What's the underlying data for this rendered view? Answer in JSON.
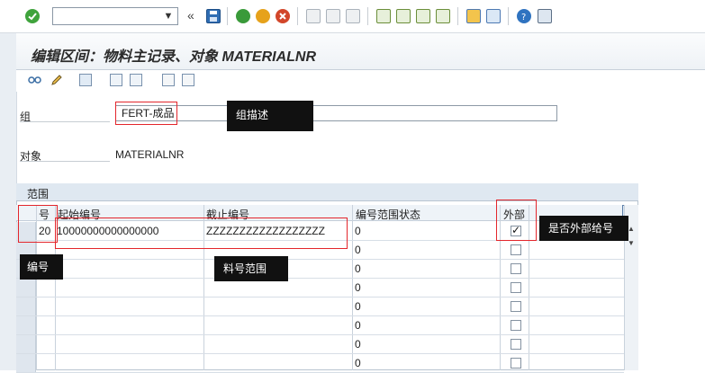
{
  "title": "编辑区间：物料主记录、对象 MATERIALNR",
  "toolbar": {
    "command_field_value": "",
    "nav_back_symbol": "«"
  },
  "form": {
    "group_label": "组",
    "group_value": "FERT-成品",
    "object_label": "对象",
    "object_value": "MATERIALNR"
  },
  "table": {
    "section_title": "范围",
    "columns": {
      "no": "号",
      "from": "起始编号",
      "to": "截止编号",
      "status": "编号范围状态",
      "external": "外部"
    },
    "rows": [
      {
        "no": "20",
        "from": "10000000000000000",
        "to": "ZZZZZZZZZZZZZZZZZZ",
        "status": "0",
        "external": true
      },
      {
        "no": "",
        "from": "",
        "to": "",
        "status": "0",
        "external": false
      },
      {
        "no": "",
        "from": "",
        "to": "",
        "status": "0",
        "external": false
      },
      {
        "no": "",
        "from": "",
        "to": "",
        "status": "0",
        "external": false
      },
      {
        "no": "",
        "from": "",
        "to": "",
        "status": "0",
        "external": false
      },
      {
        "no": "",
        "from": "",
        "to": "",
        "status": "0",
        "external": false
      },
      {
        "no": "",
        "from": "",
        "to": "",
        "status": "0",
        "external": false
      },
      {
        "no": "",
        "from": "",
        "to": "",
        "status": "0",
        "external": false
      }
    ]
  },
  "annotations": {
    "group_desc": "组描述",
    "number": "编号",
    "material_range": "料号范围",
    "external_flag": "是否外部给号"
  },
  "colors": {
    "annotation_border": "#e3262c",
    "annotation_bg": "#111111",
    "header_bg": "#dfe8f1"
  }
}
